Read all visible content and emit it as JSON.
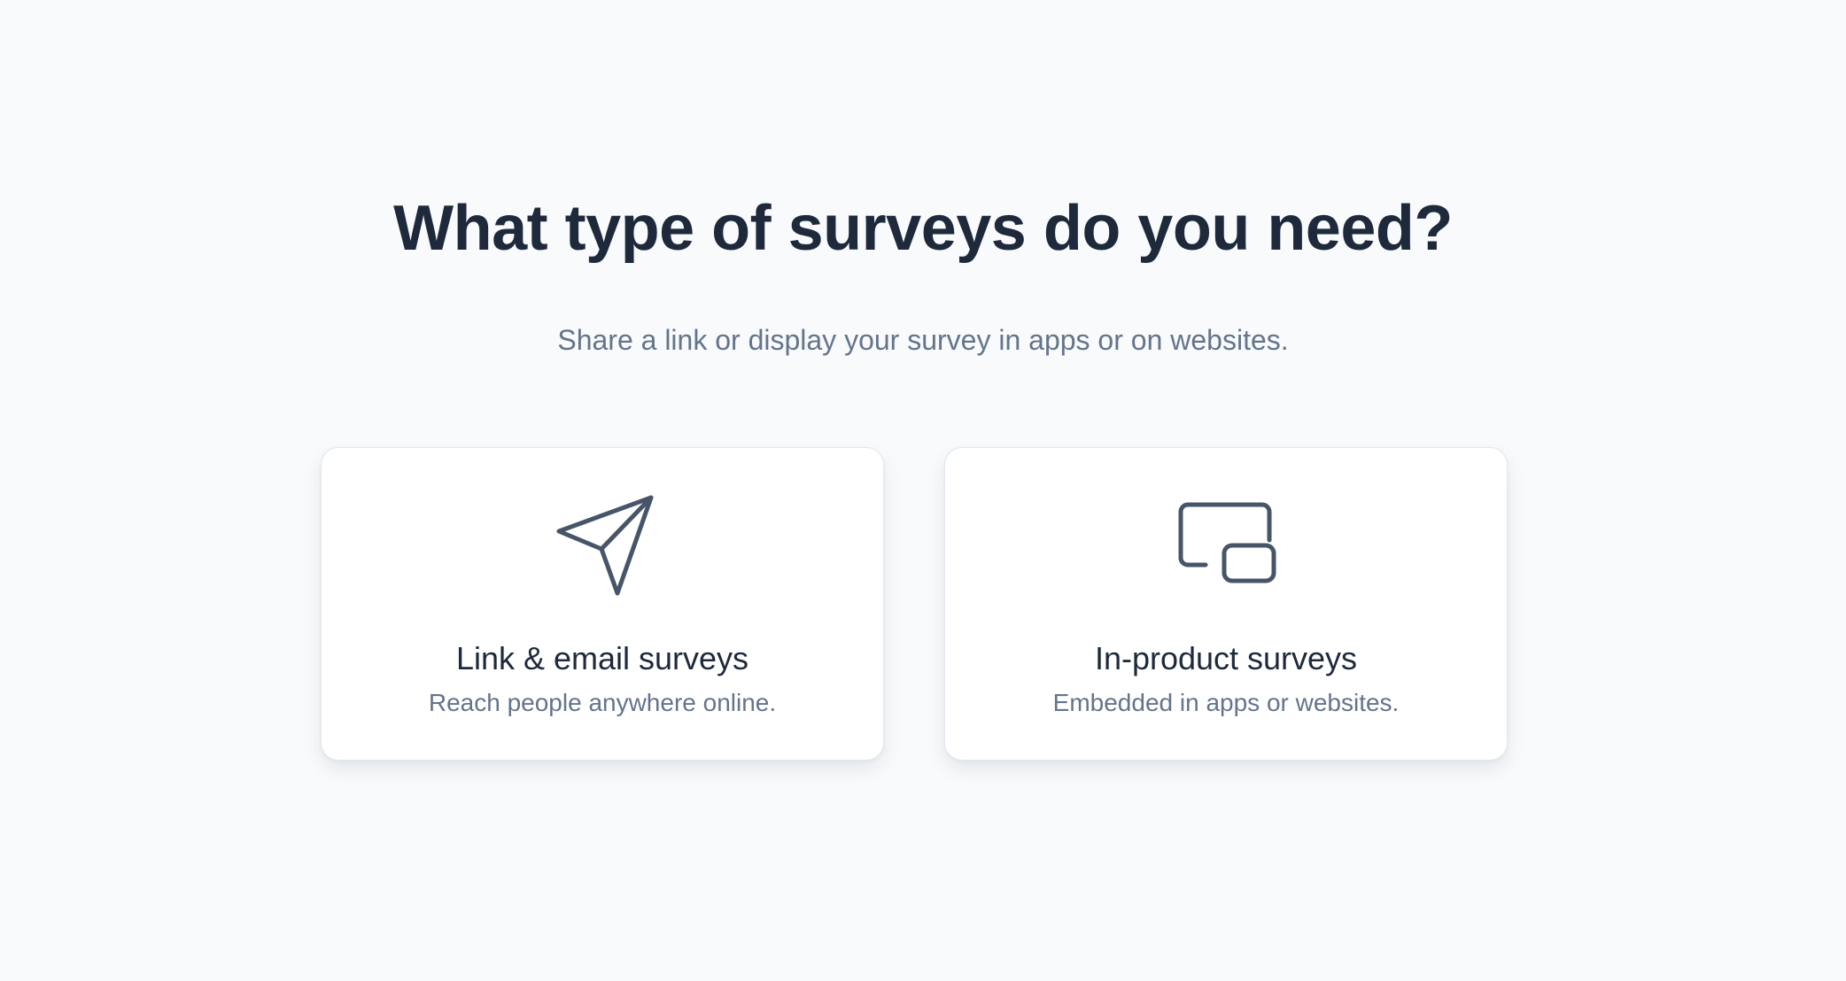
{
  "header": {
    "title": "What type of surveys do you need?",
    "subtitle": "Share a link or display your survey in apps or on websites."
  },
  "options": [
    {
      "title": "Link & email surveys",
      "description": "Reach people anywhere online.",
      "icon": "paper-plane-icon"
    },
    {
      "title": "In-product surveys",
      "description": "Embedded in apps or websites.",
      "icon": "picture-in-picture-icon"
    }
  ],
  "colors": {
    "background": "#f8fafc",
    "card": "#ffffff",
    "title": "#1e293b",
    "muted": "#64748b",
    "icon_stroke": "#475569"
  }
}
